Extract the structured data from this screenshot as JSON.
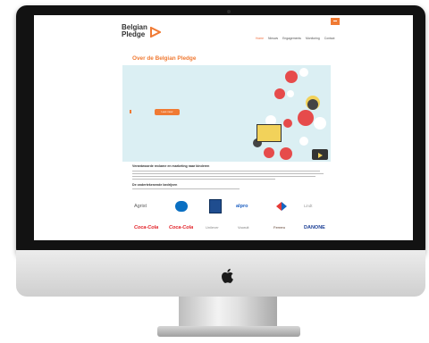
{
  "site": {
    "logo_line1": "Belgian",
    "logo_line2": "Pledge",
    "nav": [
      "Home",
      "Nieuws",
      "Engagements",
      "Monitoring",
      "Contact"
    ],
    "page_title": "Over de Belgian Pledge",
    "hero_button": "Lees meer",
    "section1_title": "Verantwoorde reclame en marketing naar kinderen",
    "section2_title": "De ondertekenende bedrijven",
    "brands": [
      "Agrist",
      "Carrefour",
      "Aldi",
      "alpro",
      "Carrefour",
      "Lindt",
      "Coca-Cola",
      "Coca-Cola",
      "Unilever",
      "Vooruit",
      "Ferrero",
      "DANONE"
    ]
  },
  "colors": {
    "accent": "#f07a33",
    "hero_bg": "#dbeff3",
    "bezel": "#121212"
  },
  "icons": [
    "apple-logo-icon",
    "play-logo-icon"
  ]
}
